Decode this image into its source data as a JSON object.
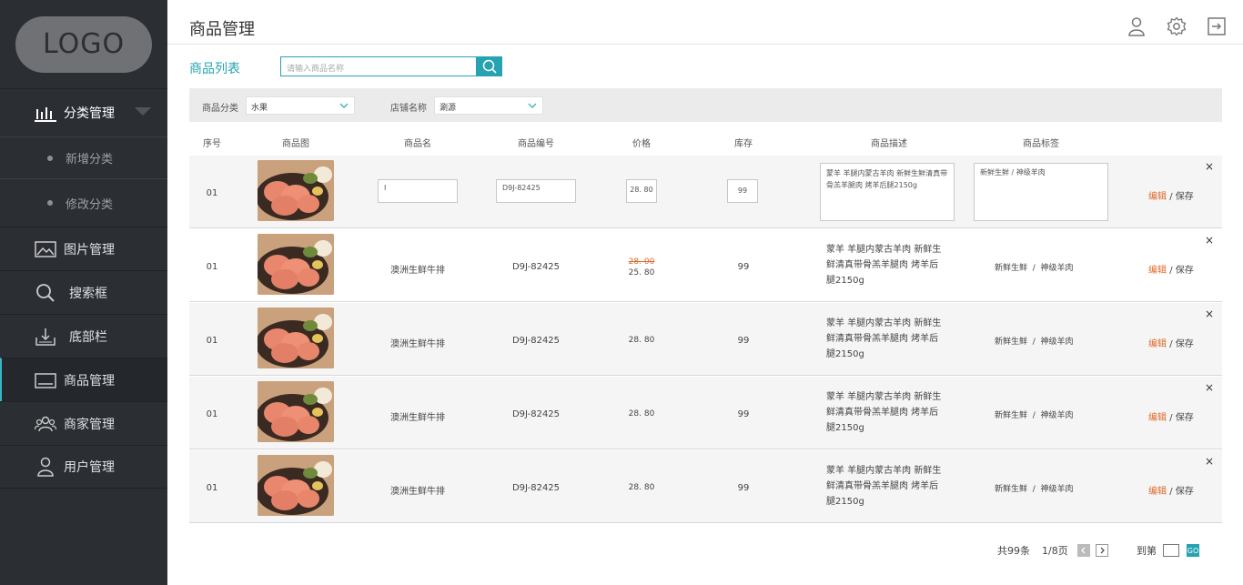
{
  "sidebar": {
    "logo": "LOGO",
    "category_menu": {
      "label": "分类管理",
      "items": [
        "新增分类",
        "修改分类"
      ]
    },
    "items": [
      {
        "label": "图片管理",
        "icon": "image-icon"
      },
      {
        "label": "搜索框",
        "icon": "search-icon"
      },
      {
        "label": "底部栏",
        "icon": "download-icon"
      },
      {
        "label": "商品管理",
        "icon": "keyboard-icon",
        "active": true
      },
      {
        "label": "商家管理",
        "icon": "users-icon"
      },
      {
        "label": "用户管理",
        "icon": "user-icon"
      }
    ]
  },
  "header": {
    "title": "商品管理",
    "icons": [
      "user-icon",
      "gear-icon",
      "logout-icon"
    ]
  },
  "list": {
    "title": "商品列表",
    "search_placeholder": "请输入商品名称"
  },
  "filters": {
    "category_label": "商品分类",
    "category_value": "水果",
    "shop_label": "店铺名称",
    "shop_value": "涮源"
  },
  "table": {
    "headers": [
      "序号",
      "商品图",
      "商品名",
      "商品编号",
      "价格",
      "库存",
      "商品描述",
      "商品标签"
    ],
    "edit_row": {
      "index": "01",
      "name_value": "I",
      "code_value": "D9J-82425",
      "price_value": "28. 80",
      "stock_value": "99",
      "desc_value": "蒙羊 羊腿内蒙古羊肉 新鲜生鲜清真带骨羔羊腿肉 烤羊后腿2150g",
      "tags_value": "新鲜生鲜 / 神级羊肉",
      "edit_label": "编辑",
      "save_label": "/ 保存",
      "close": "×"
    },
    "rows": [
      {
        "index": "01",
        "name": "澳洲生鲜牛排",
        "code": "D9J-82425",
        "old_price": "28. 00",
        "price": "25. 80",
        "stock": "99",
        "desc": "蒙羊 羊腿内蒙古羊肉 新鲜生鲜清真带骨羔羊腿肉 烤羊后腿2150g",
        "tag1": "新鲜生鲜",
        "tag2": "神级羊肉",
        "edit": "编辑",
        "save": "/ 保存",
        "close": "×"
      },
      {
        "index": "01",
        "name": "澳洲生鲜牛排",
        "code": "D9J-82425",
        "price": "28. 80",
        "stock": "99",
        "desc": "蒙羊 羊腿内蒙古羊肉 新鲜生鲜清真带骨羔羊腿肉 烤羊后腿2150g",
        "tag1": "新鲜生鲜",
        "tag2": "神级羊肉",
        "edit": "编辑",
        "save": "/ 保存",
        "close": "×"
      },
      {
        "index": "01",
        "name": "澳洲生鲜牛排",
        "code": "D9J-82425",
        "price": "28. 80",
        "stock": "99",
        "desc": "蒙羊 羊腿内蒙古羊肉 新鲜生鲜清真带骨羔羊腿肉 烤羊后腿2150g",
        "tag1": "新鲜生鲜",
        "tag2": "神级羊肉",
        "edit": "编辑",
        "save": "/ 保存",
        "close": "×"
      },
      {
        "index": "01",
        "name": "澳洲生鲜牛排",
        "code": "D9J-82425",
        "price": "28. 80",
        "stock": "99",
        "desc": "蒙羊 羊腿内蒙古羊肉 新鲜生鲜清真带骨羔羊腿肉 烤羊后腿2150g",
        "tag1": "新鲜生鲜",
        "tag2": "神级羊肉",
        "edit": "编辑",
        "save": "/ 保存",
        "close": "×"
      }
    ]
  },
  "pagination": {
    "total": "共99条",
    "page": "1/8页",
    "goto": "到第",
    "go": "GO"
  },
  "colors": {
    "accent": "#26a3b1",
    "edit": "#e06a2c",
    "sidebar": "#2b2f34"
  }
}
